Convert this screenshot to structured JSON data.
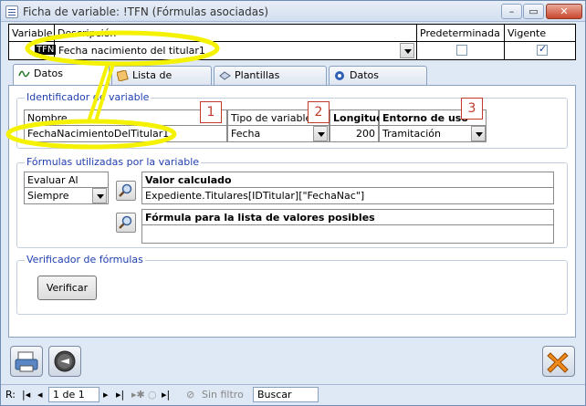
{
  "window": {
    "title": "Ficha de variable: !TFN (Fórmulas asociadas)"
  },
  "header": {
    "col_variable": "Variable",
    "col_descripcion": "Descripción",
    "col_predeterminada": "Predeterminada",
    "col_vigente": "Vigente",
    "variable_value": "TFN",
    "descripcion_value": "Fecha nacimiento del titular1",
    "predeterminada_checked": false,
    "vigente_checked": true
  },
  "tabs": [
    {
      "label": "Datos generales",
      "icon": "formula-icon"
    },
    {
      "label": "Lista de valores",
      "icon": "list-icon"
    },
    {
      "label": "Plantillas afectadas",
      "icon": "template-icon"
    },
    {
      "label": "Datos generales",
      "icon": "info-icon"
    }
  ],
  "identificador": {
    "group_label": "Identificador de variable",
    "nombre_label": "Nombre",
    "nombre_value": "FechaNacimientoDelTitular1",
    "tipo_label": "Tipo de variable",
    "tipo_value": "Fecha",
    "longitud_label": "Longitud",
    "longitud_value": "200",
    "entorno_label": "Entorno de uso",
    "entorno_value": "Tramitación"
  },
  "badges": [
    "1",
    "2",
    "3"
  ],
  "formulas": {
    "group_label": "Fórmulas utilizadas por la variable",
    "evaluar_label": "Evaluar Al",
    "evaluar_value": "Siempre",
    "valor_label": "Valor calculado",
    "valor_value": "Expediente.Titulares[IDTitular][\"FechaNac\"]",
    "lista_label": "Fórmula para la lista de valores posibles",
    "lista_value": ""
  },
  "verificador": {
    "group_label": "Verificador de fórmulas",
    "button_label": "Verificar"
  },
  "navbar": {
    "record_prefix": "R:",
    "record_value": "1 de 1",
    "filter_label": "Sin filtro",
    "search_label": "Buscar"
  },
  "colors": {
    "highlight": "#f4f200",
    "badge": "#c0392b",
    "group_label": "#1f3fb0"
  }
}
